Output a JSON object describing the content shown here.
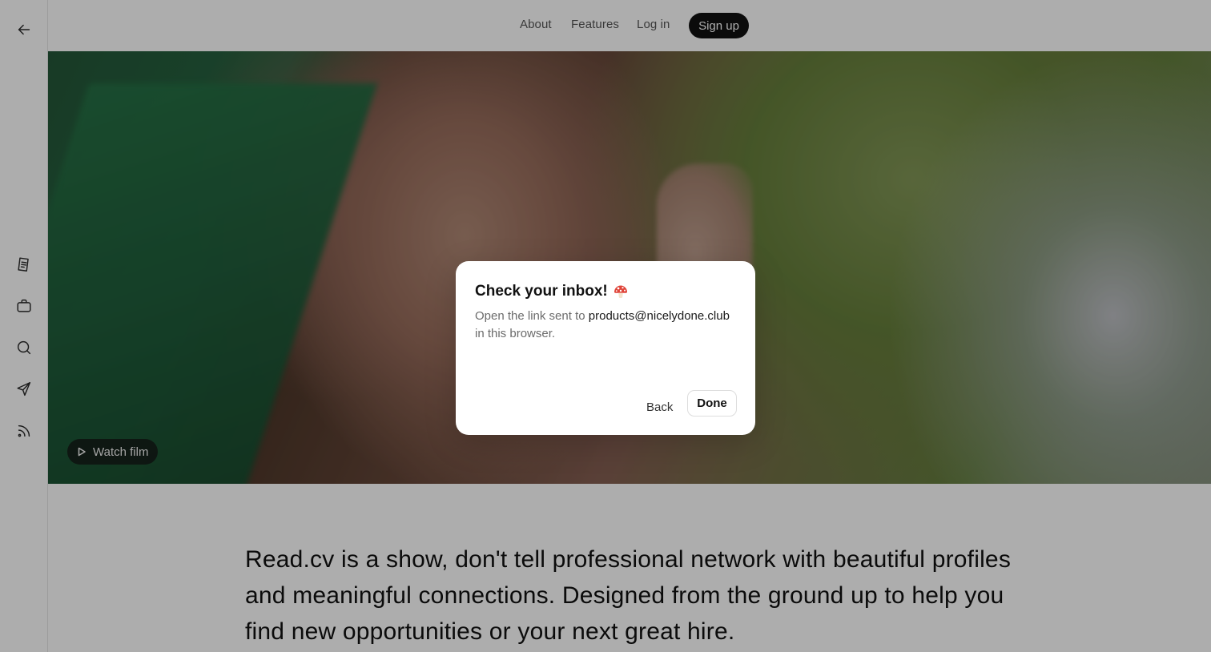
{
  "nav": {
    "about": "About",
    "features": "Features",
    "login": "Log in",
    "signup": "Sign up"
  },
  "rail": {
    "icons": [
      "back-arrow-icon",
      "document-icon",
      "briefcase-icon",
      "search-icon",
      "send-icon",
      "rss-icon"
    ]
  },
  "hero": {
    "watch_label": "Watch film"
  },
  "intro": {
    "text": "Read.cv is a show, don't tell professional network with beautiful profiles and meaningful connections. Designed from the ground up to help you find new opportunities or your next great hire."
  },
  "modal": {
    "title": "Check your inbox!",
    "body_prefix": "Open the link sent to ",
    "email": "products@nicelydone.club",
    "body_suffix": " in this browser.",
    "back": "Back",
    "done": "Done"
  },
  "colors": {
    "overlay": "rgba(0,0,0,0.32)",
    "signup_bg": "#111111",
    "modal_bg": "#ffffff"
  }
}
